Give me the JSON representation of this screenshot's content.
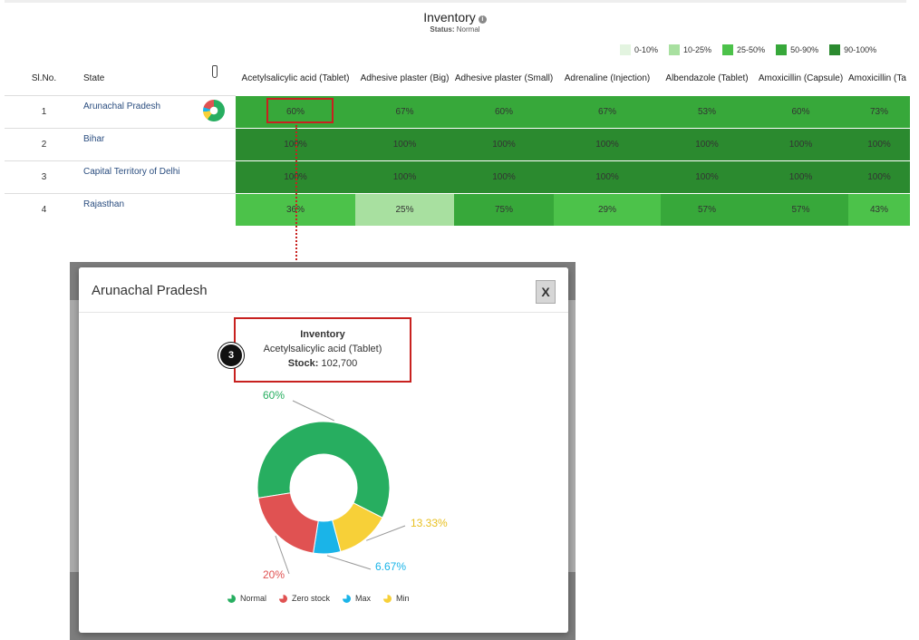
{
  "header": {
    "title": "Inventory",
    "status_label": "Status:",
    "status_value": "Normal"
  },
  "legend": [
    {
      "label": "0-10%",
      "color": "#e3f4e0"
    },
    {
      "label": "10-25%",
      "color": "#a8e0a0"
    },
    {
      "label": "25-50%",
      "color": "#4cc24a"
    },
    {
      "label": "50-90%",
      "color": "#37a83a"
    },
    {
      "label": "90-100%",
      "color": "#2b8a2f"
    }
  ],
  "table": {
    "col_slno": "Sl.No.",
    "col_state": "State",
    "medicines": [
      "Acetylsalicylic acid (Tablet)",
      "Adhesive plaster (Big)",
      "Adhesive plaster (Small)",
      "Adrenaline (Injection)",
      "Albendazole (Tablet)",
      "Amoxicillin (Capsule)",
      "Amoxicillin (Ta"
    ],
    "rows": [
      {
        "sl": "1",
        "state": "Arunachal Pradesh",
        "values": [
          "60%",
          "67%",
          "60%",
          "67%",
          "53%",
          "60%",
          "73%"
        ],
        "colors": [
          "#37a83a",
          "#37a83a",
          "#37a83a",
          "#37a83a",
          "#37a83a",
          "#37a83a",
          "#37a83a"
        ]
      },
      {
        "sl": "2",
        "state": "Bihar",
        "values": [
          "100%",
          "100%",
          "100%",
          "100%",
          "100%",
          "100%",
          "100%"
        ],
        "colors": [
          "#2b8a2f",
          "#2b8a2f",
          "#2b8a2f",
          "#2b8a2f",
          "#2b8a2f",
          "#2b8a2f",
          "#2b8a2f"
        ]
      },
      {
        "sl": "3",
        "state": "Capital Territory of Delhi",
        "values": [
          "100%",
          "100%",
          "100%",
          "100%",
          "100%",
          "100%",
          "100%"
        ],
        "colors": [
          "#2b8a2f",
          "#2b8a2f",
          "#2b8a2f",
          "#2b8a2f",
          "#2b8a2f",
          "#2b8a2f",
          "#2b8a2f"
        ]
      },
      {
        "sl": "4",
        "state": "Rajasthan",
        "values": [
          "36%",
          "25%",
          "75%",
          "29%",
          "57%",
          "57%",
          "43%"
        ],
        "colors": [
          "#4cc24a",
          "#a8e0a0",
          "#37a83a",
          "#4cc24a",
          "#37a83a",
          "#37a83a",
          "#4cc24a"
        ]
      }
    ]
  },
  "modal": {
    "title": "Arunachal Pradesh",
    "close_label": "X",
    "badge": "3",
    "tooltip": {
      "title": "Inventory",
      "item": "Acetylsalicylic acid (Tablet)",
      "stock_label": "Stock:",
      "stock_value": "102,700"
    }
  },
  "chart_data": {
    "type": "pie",
    "donut": true,
    "series": [
      {
        "name": "Normal",
        "value": 60,
        "label": "60%",
        "color": "#27ae60"
      },
      {
        "name": "Min",
        "value": 13.33,
        "label": "13.33%",
        "color": "#f7d038"
      },
      {
        "name": "Max",
        "value": 6.67,
        "label": "6.67%",
        "color": "#1ab4e8"
      },
      {
        "name": "Zero stock",
        "value": 20,
        "label": "20%",
        "color": "#e05252"
      }
    ],
    "legend_order": [
      "Normal",
      "Zero stock",
      "Max",
      "Min"
    ]
  }
}
